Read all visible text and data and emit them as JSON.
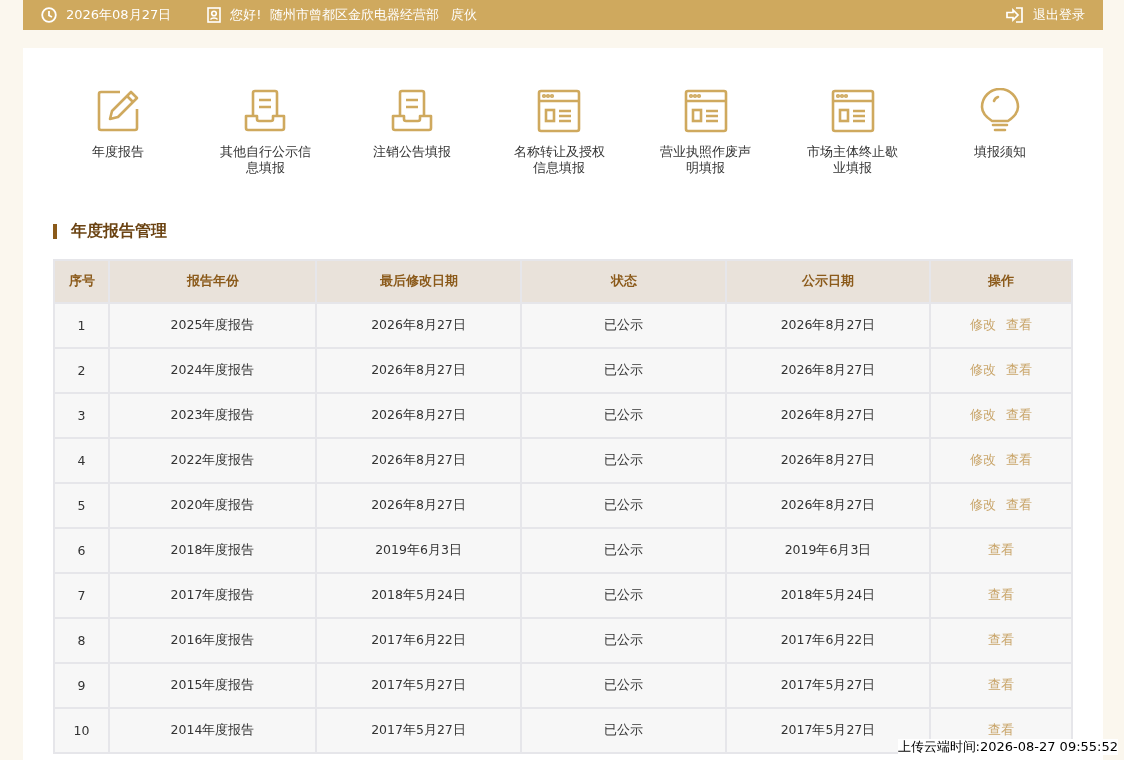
{
  "top_bar": {
    "date": "2026年08月27日",
    "greeting": "您好!  随州市曾都区金欣电器经营部   庹伙",
    "logout": "退出登录"
  },
  "features": [
    {
      "kind": "edit",
      "label": "年度报告"
    },
    {
      "kind": "tray",
      "label": "其他自行公示信息填报"
    },
    {
      "kind": "tray",
      "label": "注销公告填报"
    },
    {
      "kind": "window",
      "label": "名称转让及授权信息填报"
    },
    {
      "kind": "window",
      "label": "营业执照作废声明填报"
    },
    {
      "kind": "window",
      "label": "市场主体终止歇业填报"
    },
    {
      "kind": "bulb",
      "label": "填报须知"
    }
  ],
  "section_title": "年度报告管理",
  "table": {
    "columns": [
      "序号",
      "报告年份",
      "最后修改日期",
      "状态",
      "公示日期",
      "操作"
    ],
    "rows": [
      {
        "cells": [
          "1",
          "2025年度报告",
          "2026年8月27日",
          "已公示",
          "2026年8月27日"
        ],
        "actions": [
          "修改",
          "查看"
        ]
      },
      {
        "cells": [
          "2",
          "2024年度报告",
          "2026年8月27日",
          "已公示",
          "2026年8月27日"
        ],
        "actions": [
          "修改",
          "查看"
        ]
      },
      {
        "cells": [
          "3",
          "2023年度报告",
          "2026年8月27日",
          "已公示",
          "2026年8月27日"
        ],
        "actions": [
          "修改",
          "查看"
        ]
      },
      {
        "cells": [
          "4",
          "2022年度报告",
          "2026年8月27日",
          "已公示",
          "2026年8月27日"
        ],
        "actions": [
          "修改",
          "查看"
        ]
      },
      {
        "cells": [
          "5",
          "2020年度报告",
          "2026年8月27日",
          "已公示",
          "2026年8月27日"
        ],
        "actions": [
          "修改",
          "查看"
        ]
      },
      {
        "cells": [
          "6",
          "2018年度报告",
          "2019年6月3日",
          "已公示",
          "2019年6月3日"
        ],
        "actions": [
          "查看"
        ]
      },
      {
        "cells": [
          "7",
          "2017年度报告",
          "2018年5月24日",
          "已公示",
          "2018年5月24日"
        ],
        "actions": [
          "查看"
        ]
      },
      {
        "cells": [
          "8",
          "2016年度报告",
          "2017年6月22日",
          "已公示",
          "2017年6月22日"
        ],
        "actions": [
          "查看"
        ]
      },
      {
        "cells": [
          "9",
          "2015年度报告",
          "2017年5月27日",
          "已公示",
          "2017年5月27日"
        ],
        "actions": [
          "查看"
        ]
      },
      {
        "cells": [
          "10",
          "2014年度报告",
          "2017年5月27日",
          "已公示",
          "2017年5月27日"
        ],
        "actions": [
          "查看"
        ]
      }
    ]
  },
  "upload_stamp": "上传云端时间:2026-08-27 09:55:52"
}
